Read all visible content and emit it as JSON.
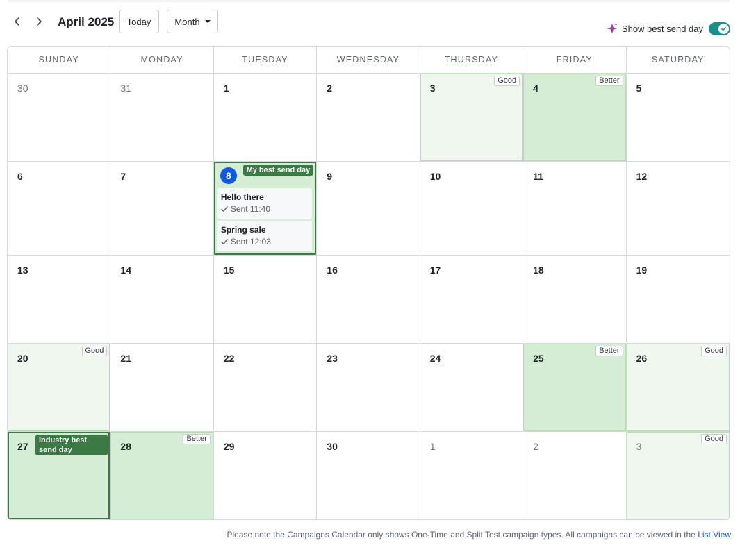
{
  "header": {
    "month_title": "April 2025",
    "today_label": "Today",
    "view_select": "Month",
    "best_send_label": "Show best send day",
    "best_send_enabled": true
  },
  "weekdays": [
    "SUNDAY",
    "MONDAY",
    "TUESDAY",
    "WEDNESDAY",
    "THURSDAY",
    "FRIDAY",
    "SATURDAY"
  ],
  "tags": {
    "good": "Good",
    "better": "Better"
  },
  "badges": {
    "my_best": "My best send day",
    "industry_best": "Industry best send day"
  },
  "days": [
    {
      "n": "30",
      "muted": true
    },
    {
      "n": "31",
      "muted": true
    },
    {
      "n": "1"
    },
    {
      "n": "2"
    },
    {
      "n": "3",
      "tag": "Good"
    },
    {
      "n": "4",
      "tag": "Better"
    },
    {
      "n": "5"
    },
    {
      "n": "6"
    },
    {
      "n": "7"
    },
    {
      "n": "8",
      "today": true,
      "my_best": true
    },
    {
      "n": "9"
    },
    {
      "n": "10"
    },
    {
      "n": "11"
    },
    {
      "n": "12"
    },
    {
      "n": "13"
    },
    {
      "n": "14"
    },
    {
      "n": "15"
    },
    {
      "n": "16"
    },
    {
      "n": "17"
    },
    {
      "n": "18"
    },
    {
      "n": "19"
    },
    {
      "n": "20",
      "tag": "Good"
    },
    {
      "n": "21"
    },
    {
      "n": "22"
    },
    {
      "n": "23"
    },
    {
      "n": "24"
    },
    {
      "n": "25",
      "tag": "Better"
    },
    {
      "n": "26",
      "tag": "Good"
    },
    {
      "n": "27",
      "industry_best": true
    },
    {
      "n": "28",
      "tag": "Better"
    },
    {
      "n": "29"
    },
    {
      "n": "30"
    },
    {
      "n": "1",
      "muted": true
    },
    {
      "n": "2",
      "muted": true
    },
    {
      "n": "3",
      "muted": true,
      "tag": "Good"
    }
  ],
  "campaigns": [
    {
      "title": "Hello there",
      "status": "Sent 11:40"
    },
    {
      "title": "Spring sale",
      "status": "Sent 12:03"
    }
  ],
  "footer": {
    "note": "Please note the Campaigns Calendar only shows One-Time and Split Test campaign types. All campaigns can be viewed in the ",
    "link": "List View"
  },
  "colors": {
    "good_bg": "#eff7ee",
    "better_bg": "#d5ecd5",
    "highlight": "#3b7a45",
    "today": "#1158e0",
    "toggle": "#1a8f8a"
  }
}
